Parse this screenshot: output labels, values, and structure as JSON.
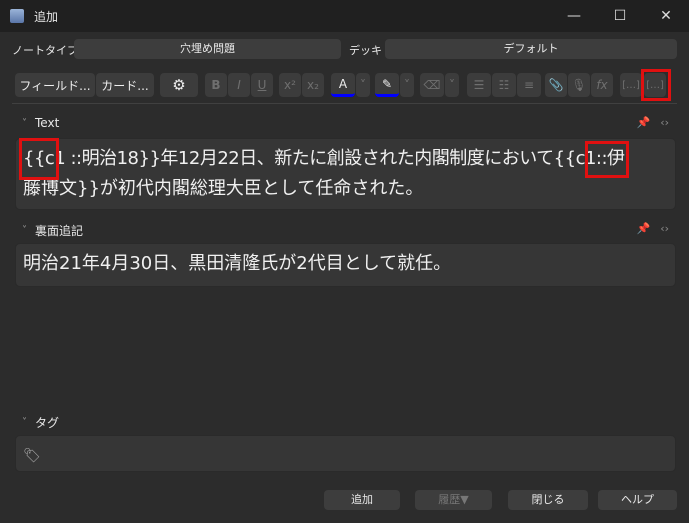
{
  "window": {
    "title": "追加",
    "minimize": "—",
    "maximize": "☐",
    "close": "✕"
  },
  "top": {
    "notetype_label": "ノートタイプ",
    "notetype_value": "穴埋め問題",
    "deck_label": "デッキ",
    "deck_value": "デフォルト"
  },
  "toolbar": {
    "fields": "フィールド...",
    "cards": "カード...",
    "gear": "⚙",
    "bold": "B",
    "italic": "I",
    "underline": "U",
    "sup": "x²",
    "sub": "x₂",
    "color": "A",
    "highlight": "✎",
    "eraser": "⌫",
    "ul": "☰",
    "ol": "☷",
    "align": "≡",
    "attach": "📎",
    "mic": "🎙",
    "fx": "fx",
    "cloze_new": "[…]",
    "cloze": "[…]",
    "dropdown": "˅"
  },
  "fields": [
    {
      "label": "Text",
      "value_lines": [
        "{{c1 ::明治18}}年12月22日、新たに創設された内閣制度において{{c1::伊",
        "藤博文}}が初代内閣総理大臣として任命された。"
      ]
    },
    {
      "label": "裏面追記",
      "value": "明治21年4月30日、黒田清隆氏が2代目として就任。"
    }
  ],
  "tags": {
    "label": "タグ"
  },
  "buttons": {
    "add": "追加",
    "history": "履歴▼",
    "close": "閉じる",
    "help": "ヘルプ"
  },
  "colors": {
    "annotation": "#e01010",
    "text_color_bar": "#0000ff"
  }
}
